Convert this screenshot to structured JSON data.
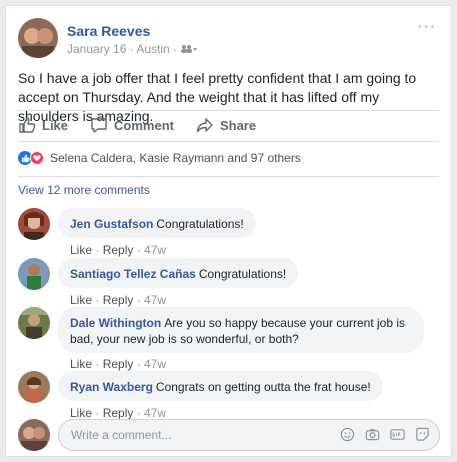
{
  "post": {
    "author": "Sara Reeves",
    "date": "January 16",
    "separator": "·",
    "location": "Austin",
    "text": "So I have a job offer that I feel pretty confident that I am going to accept on Thursday. And the weight that it has lifted off my shoulders is amazing."
  },
  "actions": {
    "like": "Like",
    "comment": "Comment",
    "share": "Share"
  },
  "reactions": {
    "summary": "Selena Caldera, Kasie Raymann and 97 others"
  },
  "view_more": "View 12 more comments",
  "comments": [
    {
      "name": "Jen Gustafson",
      "text": "Congratulations!",
      "like": "Like",
      "reply": "Reply",
      "time": "47w"
    },
    {
      "name": "Santiago Tellez Cañas",
      "text": "Congratulations!",
      "like": "Like",
      "reply": "Reply",
      "time": "47w"
    },
    {
      "name": "Dale Withington",
      "text": "Are you so happy because your current job is bad, your new job is so wonderful, or both?",
      "like": "Like",
      "reply": "Reply",
      "time": "47w"
    },
    {
      "name": "Ryan Waxberg",
      "text": "Congrats on getting outta the frat house!",
      "like": "Like",
      "reply": "Reply",
      "time": "47w"
    }
  ],
  "composer": {
    "placeholder": "Write a comment..."
  },
  "colors": {
    "link": "#385898",
    "like_blue": "#1877f2",
    "love_red": "#f33e58",
    "muted": "#90949c"
  }
}
